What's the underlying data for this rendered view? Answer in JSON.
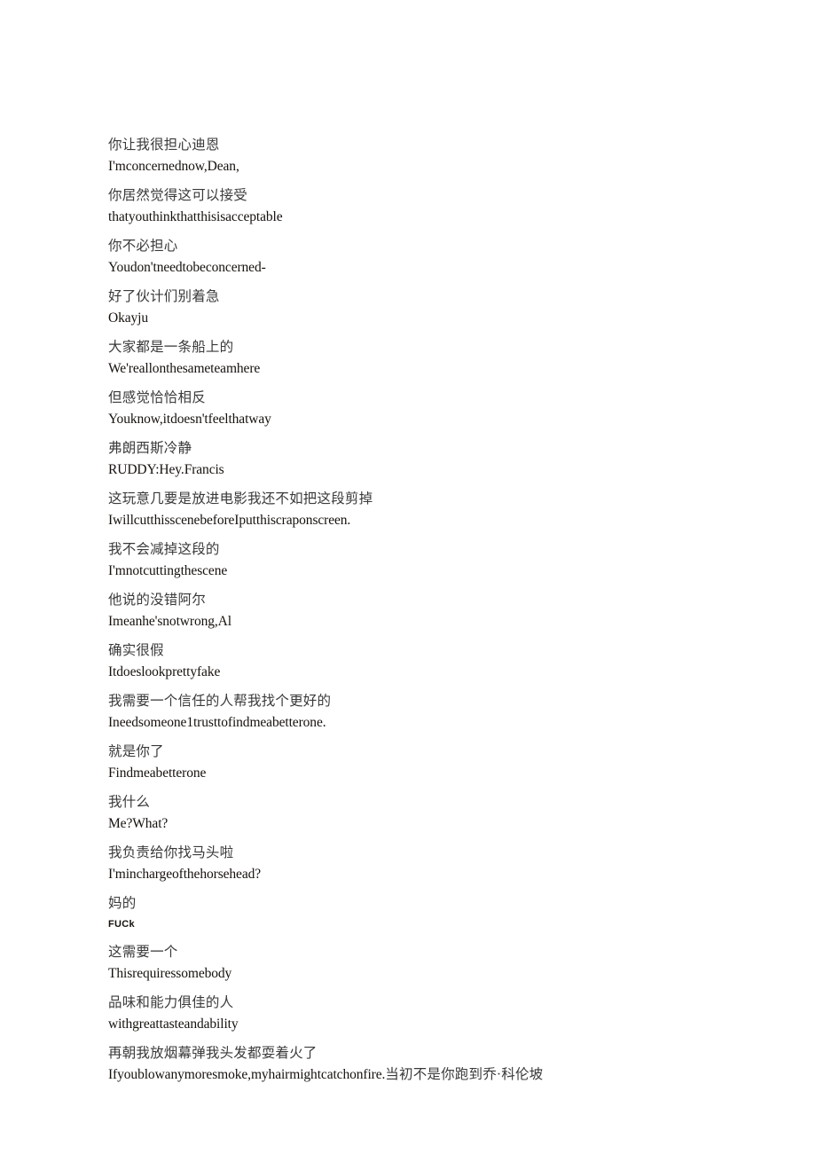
{
  "document": {
    "kind": "bilingual-subtitle-transcript",
    "background_color": "#ffffff",
    "zh_text_color": "#3a3a3a",
    "en_text_color": "#16100d"
  },
  "blocks": [
    {
      "zh": "你让我很担心迪恩",
      "en": "I'mconcernednow,Dean,"
    },
    {
      "zh": "你居然觉得这可以接受",
      "en": "thatyouthinkthatthisisacceptable"
    },
    {
      "zh": "你不必担心",
      "en": "Youdon'tneedtobeconcerned-"
    },
    {
      "zh": "好了伙计们别着急",
      "en": "Okayju"
    },
    {
      "zh": "大家都是一条船上的",
      "en": "We'reallonthesameteamhere"
    },
    {
      "zh": "但感觉恰恰相反",
      "en": "Youknow,itdoesn'tfeelthatway"
    },
    {
      "zh": "弗朗西斯冷静",
      "en": "RUDDY:Hey.Francis"
    },
    {
      "zh": "这玩意几要是放进电影我还不如把这段剪掉",
      "en": "IwillcutthisscenebeforeIputthiscraponscreen."
    },
    {
      "zh": "我不会减掉这段的",
      "en": "I'mnotcuttingthescene"
    },
    {
      "zh": "他说的没错阿尔",
      "en": "Imeanhe'snotwrong,Al"
    },
    {
      "zh": "确实很假",
      "en": "Itdoeslookprettyfake"
    },
    {
      "zh": "我需要一个信任的人帮我找个更好的",
      "en": "Ineedsomeone1trusttofindmeabetterone."
    },
    {
      "zh": "就是你了",
      "en": "Findmeabetterone"
    },
    {
      "zh": "我什么",
      "en": "Me?What?"
    },
    {
      "zh": "我负责给你找马头啦",
      "en": "I'minchargeofthehorsehead?"
    },
    {
      "zh": "妈的",
      "en": "FUCk",
      "en_style": "caption"
    },
    {
      "zh": "这需要一个",
      "en": "Thisrequiressomebody"
    },
    {
      "zh": "品味和能力俱佳的人",
      "en": "withgreattasteandability"
    },
    {
      "zh": "再朝我放烟幕弹我头发都耍着火了",
      "en": "Ifyoublowanymoresmoke,myhairmightcatchonfire.",
      "en_trailing_zh": "当初不是你跑到",
      "zh_continuation": "乔·科伦坡"
    }
  ]
}
